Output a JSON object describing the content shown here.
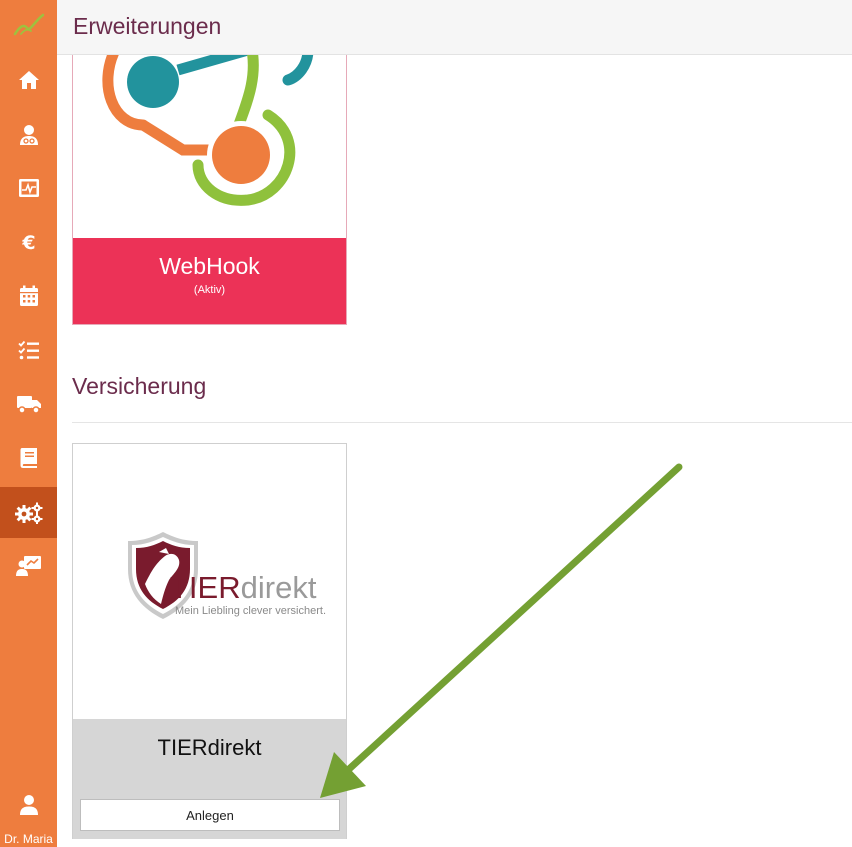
{
  "header": {
    "title": "Erweiterungen"
  },
  "sidebar": {
    "items": [
      {
        "icon": "home-icon"
      },
      {
        "icon": "patient-icon"
      },
      {
        "icon": "monitor-chart-icon"
      },
      {
        "icon": "euro-icon"
      },
      {
        "icon": "calendar-icon"
      },
      {
        "icon": "checklist-icon"
      },
      {
        "icon": "truck-icon"
      },
      {
        "icon": "book-icon"
      },
      {
        "icon": "gears-icon",
        "active": true
      },
      {
        "icon": "presentation-icon"
      }
    ],
    "user_name": "Dr. Maria"
  },
  "webhook_card": {
    "name": "WebHook",
    "status": "(Aktiv)"
  },
  "section": {
    "title": "Versicherung"
  },
  "tier_card": {
    "logo_brand_a": "TIER",
    "logo_brand_b": "direkt",
    "logo_tagline": "Mein Liebling clever versichert.",
    "name": "TIERdirekt",
    "button_label": "Anlegen"
  },
  "colors": {
    "sidebar": "#ee7d3e",
    "sidebar_active": "#c2501c",
    "heading": "#6b2c4c",
    "webhook_footer": "#ec3257",
    "tier_brand": "#7a1b2d",
    "arrow": "#74a033"
  }
}
